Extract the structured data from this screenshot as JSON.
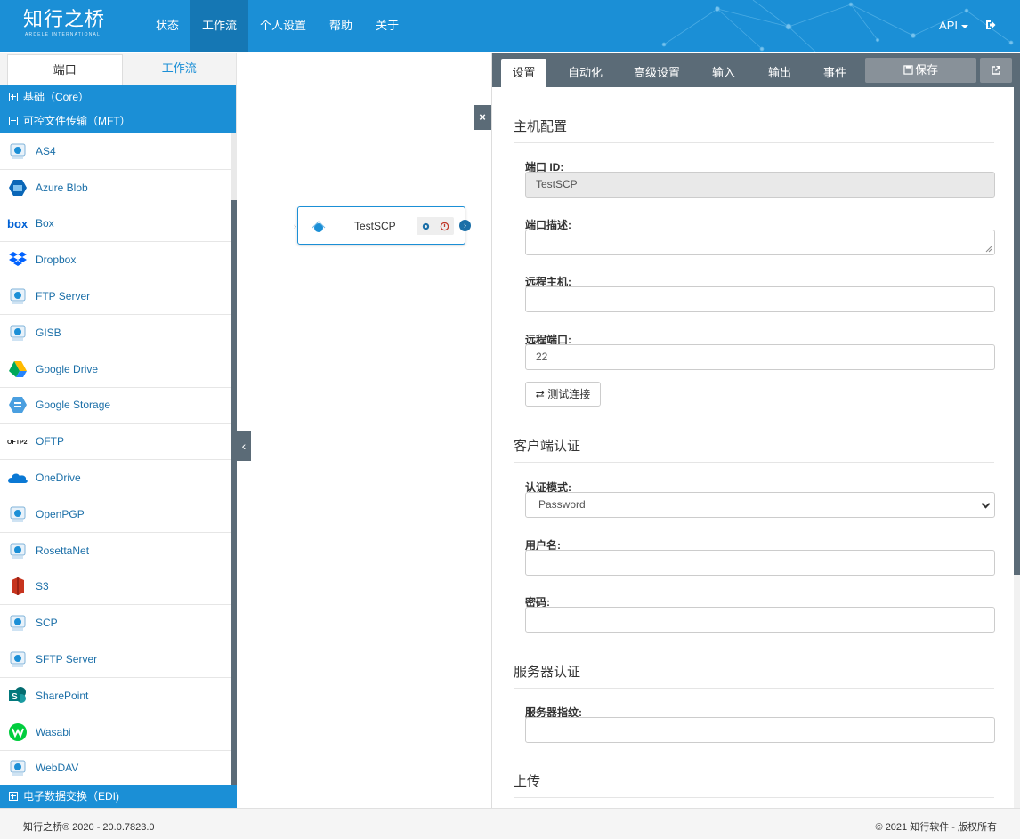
{
  "brand": {
    "logo_main": "知行之桥",
    "logo_sub": "ARDELE INTERNATIONAL"
  },
  "nav": {
    "items": [
      "状态",
      "工作流",
      "个人设置",
      "帮助",
      "关于"
    ],
    "active_index": 1,
    "api_label": "API"
  },
  "left": {
    "tabs": [
      "端口",
      "工作流"
    ],
    "groups": {
      "core": "基础（Core）",
      "mft": "可控文件传输（MFT）",
      "edi": "电子数据交换（EDI)"
    },
    "items": [
      "AS4",
      "Azure Blob",
      "Box",
      "Dropbox",
      "FTP Server",
      "GISB",
      "Google Drive",
      "Google Storage",
      "OFTP",
      "OneDrive",
      "OpenPGP",
      "RosettaNet",
      "S3",
      "SCP",
      "SFTP Server",
      "SharePoint",
      "Wasabi",
      "WebDAV"
    ],
    "icon_names": [
      "as4-icon",
      "azure-blob-icon",
      "box-icon",
      "dropbox-icon",
      "ftp-server-icon",
      "gisb-icon",
      "google-drive-icon",
      "google-storage-icon",
      "oftp-icon",
      "onedrive-icon",
      "openpgp-icon",
      "rosettanet-icon",
      "s3-icon",
      "scp-icon",
      "sftp-server-icon",
      "sharepoint-icon",
      "wasabi-icon",
      "webdav-icon"
    ]
  },
  "canvas": {
    "node_label": "TestSCP",
    "close_glyph": "×",
    "collapse_glyph": "‹"
  },
  "right": {
    "tabs": [
      "设置",
      "自动化",
      "高级设置",
      "输入",
      "输出",
      "事件"
    ],
    "save_label": "保存",
    "sections": {
      "host": "主机配置",
      "client_auth": "客户端认证",
      "server_auth": "服务器认证",
      "upload": "上传"
    },
    "fields": {
      "port_id_label": "端口 ID:",
      "port_id_value": "TestSCP",
      "desc_label": "端口描述:",
      "remote_host_label": "远程主机:",
      "remote_port_label": "远程端口:",
      "remote_port_value": "22",
      "test_conn_label": "测试连接",
      "auth_mode_label": "认证模式:",
      "auth_mode_value": "Password",
      "user_label": "用户名:",
      "password_label": "密码:",
      "fingerprint_label": "服务器指纹:"
    }
  },
  "footer": {
    "left": "知行之桥® 2020 - 20.0.7823.0",
    "right": "© 2021 知行软件 - 版权所有"
  },
  "colors": {
    "primary": "#1b8fd6",
    "dark": "#5b6b77",
    "link": "#1b6fa8"
  }
}
